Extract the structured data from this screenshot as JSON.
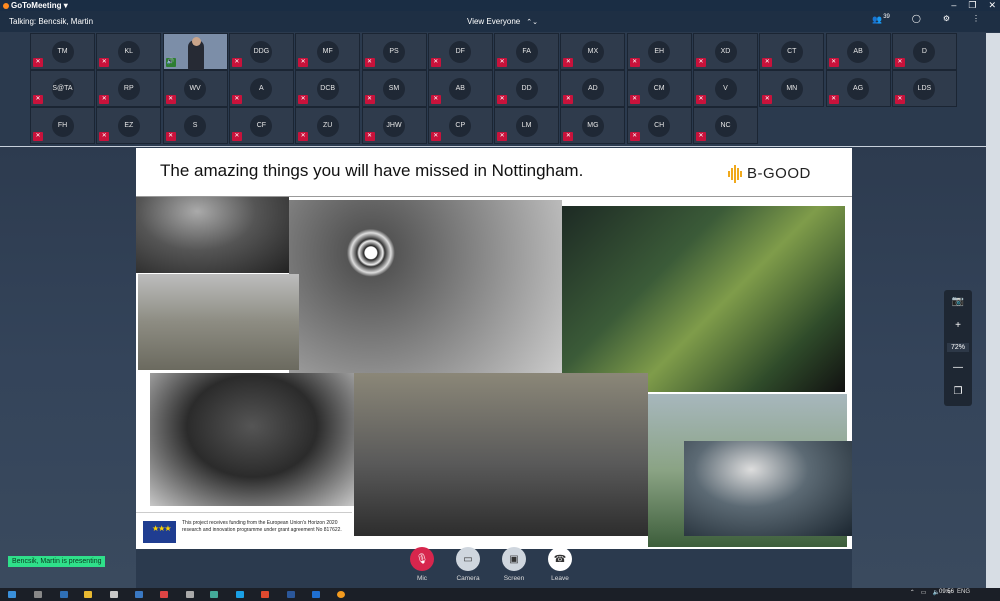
{
  "app": {
    "title": "GoToMeeting",
    "window_controls": [
      "–",
      "❐",
      "✕"
    ]
  },
  "topbar": {
    "talking": "Talking: Bencsik, Martin",
    "view": "View Everyone",
    "participant_count": "39"
  },
  "tiles": [
    {
      "initials": "TM"
    },
    {
      "initials": "KL"
    },
    {
      "initials": "",
      "video": true
    },
    {
      "initials": "DDG"
    },
    {
      "initials": "MF"
    },
    {
      "initials": "PS"
    },
    {
      "initials": "DF"
    },
    {
      "initials": "FA"
    },
    {
      "initials": "MX"
    },
    {
      "initials": "EH"
    },
    {
      "initials": "XD"
    },
    {
      "initials": "CT"
    },
    {
      "initials": "AB"
    },
    {
      "initials": "D"
    },
    {
      "initials": "S@TA"
    },
    {
      "initials": "RP"
    },
    {
      "initials": "WV"
    },
    {
      "initials": "A"
    },
    {
      "initials": "DCB"
    },
    {
      "initials": "SM"
    },
    {
      "initials": "AB"
    },
    {
      "initials": "DD"
    },
    {
      "initials": "AD"
    },
    {
      "initials": "CM"
    },
    {
      "initials": "V"
    },
    {
      "initials": "MN"
    },
    {
      "initials": "AG"
    },
    {
      "initials": "LDS"
    },
    {
      "initials": "FH"
    },
    {
      "initials": "EZ"
    },
    {
      "initials": "S"
    },
    {
      "initials": "CF"
    },
    {
      "initials": "ZU"
    },
    {
      "initials": "JHW"
    },
    {
      "initials": "CP"
    },
    {
      "initials": "LM"
    },
    {
      "initials": "MG"
    },
    {
      "initials": "CH"
    },
    {
      "initials": "NC"
    }
  ],
  "slide": {
    "title": "The amazing things you will have missed in Nottingham.",
    "brand": "B-GOOD",
    "eu_text": "This project receives funding from the European Union's Horizon 2020 research and innovation programme under grant agreement No 817622."
  },
  "sidetools": {
    "zoom": "72%"
  },
  "status": {
    "presenting": "Bencsik, Martin is presenting"
  },
  "controls": {
    "mic": "Mic",
    "camera": "Camera",
    "screen": "Screen",
    "leave": "Leave"
  },
  "taskbar": {
    "lang": "ENG",
    "time": "09:56"
  },
  "colors": {
    "accent": "#ff8a1f",
    "mute_red": "#c9123b",
    "presenting_green": "#2fe08a"
  }
}
